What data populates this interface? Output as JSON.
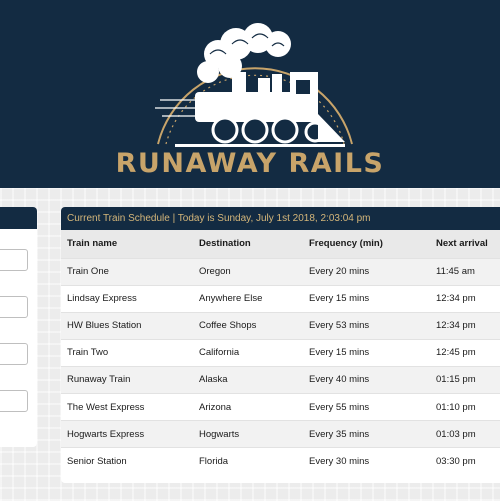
{
  "brand": {
    "title": "RUNAWAY RAILS",
    "accent": "#c8a46a",
    "header_bg": "#132b42"
  },
  "schedule": {
    "heading": "Current Train Schedule | Today is Sunday, July 1st 2018, 2:03:04 pm",
    "columns": [
      "Train name",
      "Destination",
      "Frequency (min)",
      "Next arrival"
    ],
    "rows": [
      [
        "Train One",
        "Oregon",
        "Every 20 mins",
        "11:45 am"
      ],
      [
        "Lindsay Express",
        "Anywhere Else",
        "Every 15 mins",
        "12:34 pm"
      ],
      [
        "HW Blues Station",
        "Coffee Shops",
        "Every 53 mins",
        "12:34 pm"
      ],
      [
        "Train Two",
        "California",
        "Every 15 mins",
        "12:45 pm"
      ],
      [
        "Runaway Train",
        "Alaska",
        "Every 40 mins",
        "01:15 pm"
      ],
      [
        "The West Express",
        "Arizona",
        "Every 55 mins",
        "01:10 pm"
      ],
      [
        "Hogwarts Express",
        "Hogwarts",
        "Every 35 mins",
        "01:03 pm"
      ],
      [
        "Senior Station",
        "Florida",
        "Every 30 mins",
        "03:30 pm"
      ]
    ]
  },
  "form": {
    "fields": [
      "",
      "",
      "",
      ""
    ]
  }
}
